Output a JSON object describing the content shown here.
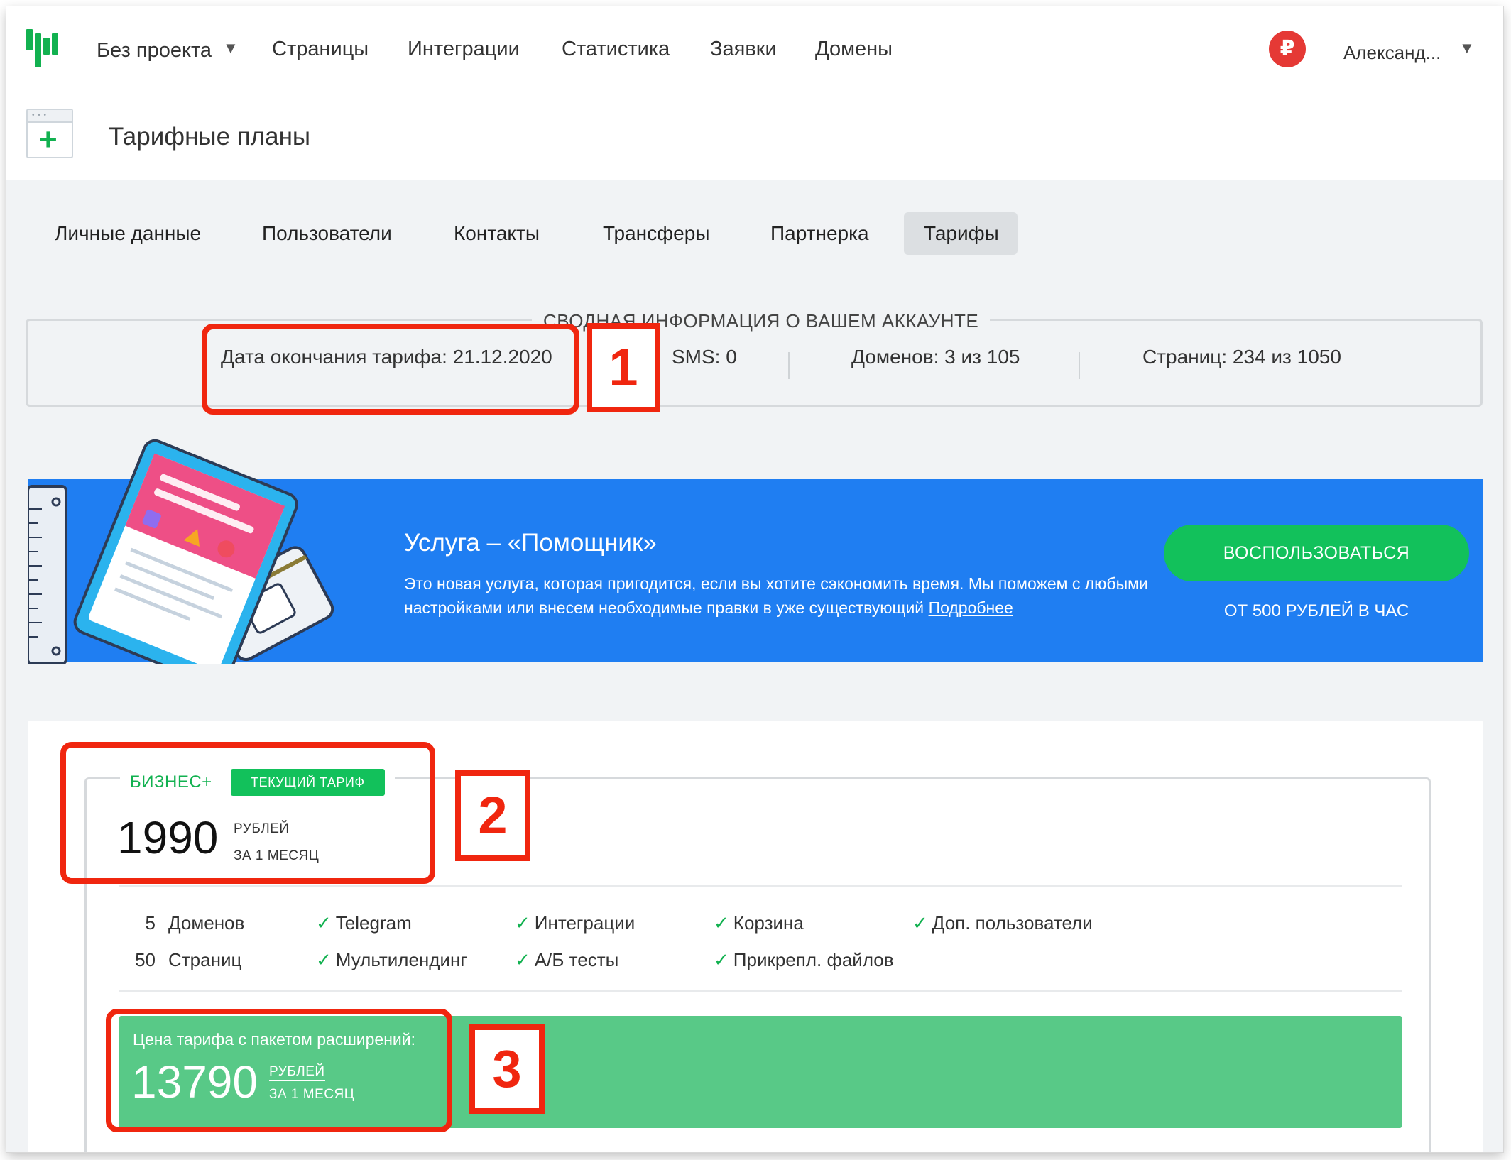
{
  "topbar": {
    "project": "Без проекта",
    "nav": [
      "Страницы",
      "Интеграции",
      "Статистика",
      "Заявки",
      "Домены"
    ],
    "currency_symbol": "₽",
    "user_name": "Александ..."
  },
  "page_header": {
    "title": "Тарифные планы"
  },
  "tabs": [
    "Личные данные",
    "Пользователи",
    "Контакты",
    "Трансферы",
    "Партнерка",
    "Тарифы"
  ],
  "active_tab": "Тарифы",
  "summary": {
    "legend": "СВОДНАЯ ИНФОРМАЦИЯ О ВАШЕМ АККАУНТЕ",
    "tariff_end": "Дата окончания тарифа: 21.12.2020",
    "sms": "SMS: 0",
    "domains": "Доменов: 3 из 105",
    "pages": "Страниц: 234 из 1050"
  },
  "banner": {
    "title": "Услуга – «Помощник»",
    "text": "Это новая услуга, которая пригодится, если вы хотите сэкономить время. Мы поможем с любыми настройками или внесем необходимые правки в уже существующий",
    "link": "Подробнее",
    "button": "ВОСПОЛЬЗОВАТЬСЯ",
    "price_note": "ОТ 500 РУБЛЕЙ В ЧАС"
  },
  "plan": {
    "name": "БИЗНЕС+",
    "badge": "ТЕКУЩИЙ ТАРИФ",
    "price": "1990",
    "unit_currency": "РУБЛЕЙ",
    "unit_period": "ЗА 1 МЕСЯЦ",
    "limits": [
      {
        "num": "5",
        "label": "Доменов"
      },
      {
        "num": "50",
        "label": "Страниц"
      }
    ],
    "features": [
      "Telegram",
      "Интеграции",
      "Корзина",
      "Доп. пользователи",
      "Мультилендинг",
      "А/Б тесты",
      "Прикрепл. файлов"
    ],
    "check_mark": "✓"
  },
  "extension": {
    "label": "Цена тарифа с пакетом расширений:",
    "price": "13790",
    "unit_currency": "РУБЛЕЙ",
    "unit_period": "ЗА 1 МЕСЯЦ"
  },
  "annotations": [
    "1",
    "2",
    "3"
  ],
  "colors": {
    "brand_green": "#12b150",
    "banner_blue": "#1f7ef2",
    "button_green": "#12c15b",
    "extension_green": "#58c987",
    "annotation_red": "#f0260f",
    "currency_red": "#e53935"
  }
}
